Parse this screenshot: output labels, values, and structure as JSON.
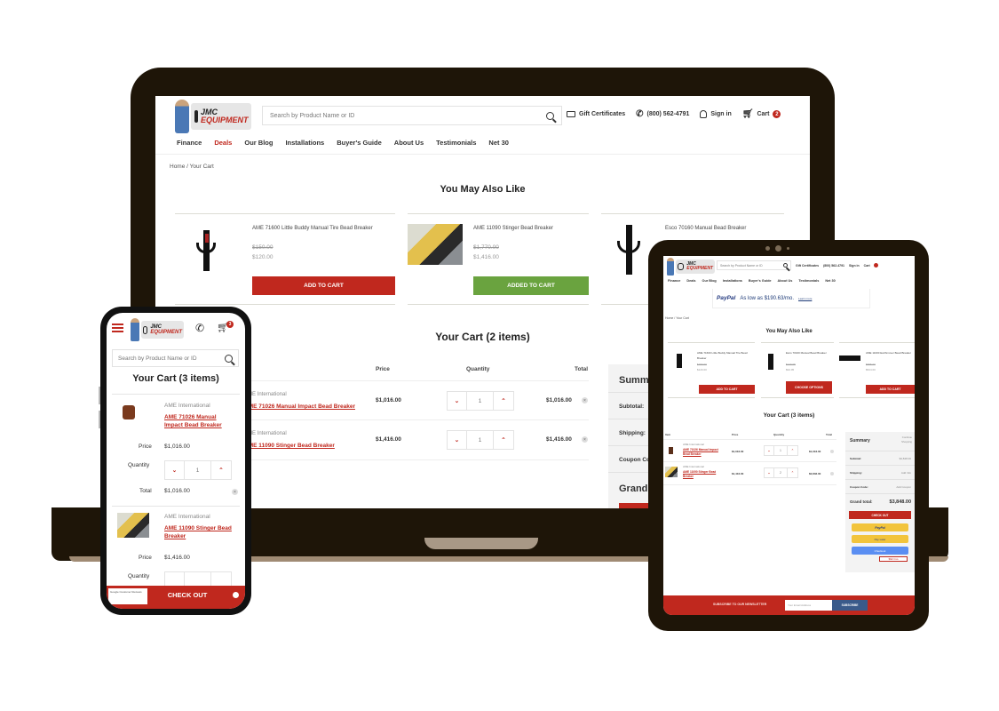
{
  "site": {
    "logo_text_top": "JMC",
    "logo_text_bottom": "EQUIPMENT",
    "search_placeholder": "Search by Product Name or ID",
    "gift_certificates": "Gift Certificates",
    "phone": "(800) 562-4791",
    "sign_in": "Sign in",
    "cart_label": "Cart",
    "cart_count": "2",
    "nav": [
      "Finance",
      "Deals",
      "Our Blog",
      "Installations",
      "Buyer's Guide",
      "About Us",
      "Testimonials",
      "Net 30"
    ],
    "breadcrumb": "Home / Your Cart",
    "accent_color": "#c0281e",
    "success_color": "#6aa33f"
  },
  "laptop": {
    "recommend_title": "You May Also Like",
    "recommendations": [
      {
        "name": "AME 71600 Little Buddy Manual Tire Bead Breaker",
        "old_price": "$150.00",
        "price": "$120.00",
        "button": "ADD TO CART",
        "state": "default"
      },
      {
        "name": "AME 11090 Stinger Bead Breaker",
        "old_price": "$1,770.00",
        "price": "$1,416.00",
        "button": "ADDED TO CART",
        "state": "added"
      },
      {
        "name": "Esco 70160 Manual Bead Breaker",
        "old_price": "",
        "price": "",
        "button": "",
        "state": "default"
      }
    ],
    "cart_title": "Your Cart (2 items)",
    "columns": {
      "price": "Price",
      "quantity": "Quantity",
      "total": "Total"
    },
    "items": [
      {
        "brand": "AME International",
        "name": "AME 71026 Manual Impact Bead Breaker",
        "price": "$1,016.00",
        "qty": "1",
        "total": "$1,016.00"
      },
      {
        "brand": "AME International",
        "name": "AME 11090 Stinger Bead Breaker",
        "price": "$1,416.00",
        "qty": "1",
        "total": "$1,416.00"
      }
    ],
    "summary": {
      "title": "Summary",
      "subtotal": "Subtotal:",
      "shipping": "Shipping:",
      "coupon": "Coupon Code:",
      "grand_total": "Grand total:"
    }
  },
  "tablet": {
    "paypal_brand": "PayPal",
    "paypal_offer": "As low as $190.63/mo.",
    "paypal_learn": "Learn more",
    "recommend_title": "You May Also Like",
    "recommendations": [
      {
        "name": "AME 71600 Little Buddy Manual Tire Bead Breaker",
        "old_price": "$150.00",
        "price": "$120.00",
        "button": "ADD TO CART"
      },
      {
        "name": "Esco 70160 Manual Bead Breaker",
        "old_price": "$129.95",
        "price": "$94.95",
        "button": "CHOOSE OPTIONS"
      },
      {
        "name": "AME 11000 Earthmover Bead Breaker",
        "old_price": "$655.00",
        "price": "$524.00",
        "button": "ADD TO CART"
      }
    ],
    "cart_title": "Your Cart (3 items)",
    "columns": {
      "item": "Item",
      "price": "Price",
      "quantity": "Quantity",
      "total": "Total"
    },
    "items": [
      {
        "brand": "AME International",
        "name": "AME 71026 Manual Impact Bead Breaker",
        "price": "$1,016.00",
        "qty": "1",
        "total": "$1,016.00"
      },
      {
        "brand": "AME International",
        "name": "AME 11090 Stinger Bead Breaker",
        "price": "$1,416.00",
        "qty": "2",
        "total": "$2,832.00"
      }
    ],
    "summary": {
      "title": "Summary",
      "continue": "Continue Shopping",
      "subtotal_label": "Subtotal:",
      "subtotal": "$3,848.00",
      "shipping_label": "Shipping:",
      "shipping": "Add Info",
      "coupon_label": "Coupon Code:",
      "coupon": "Add Coupon",
      "grand_label": "Grand total:",
      "grand": "$3,848.00",
      "checkout": "CHECK OUT",
      "paypal": "PayPal",
      "paylater": "Pay Later",
      "checkout_alt": "Checkout",
      "financing": "$92 /mo"
    },
    "newsletter": {
      "label": "SUBSCRIBE TO OUR NEWSLETTER",
      "placeholder": "Your Email Address",
      "button": "SUBSCRIBE"
    }
  },
  "phone": {
    "cart_count": "3",
    "search_placeholder": "Search by Product Name or ID",
    "cart_title": "Your Cart (3 items)",
    "labels": {
      "price": "Price",
      "quantity": "Quantity",
      "total": "Total"
    },
    "items": [
      {
        "brand": "AME International",
        "name": "AME 71026 Manual Impact Bead Breaker",
        "price": "$1,016.00",
        "qty": "1",
        "total": "$1,016.00"
      },
      {
        "brand": "AME International",
        "name": "AME 11090 Stinger Bead Breaker",
        "price": "$1,416.00",
        "qty": "",
        "total": ""
      }
    ],
    "checkout": "CHECK OUT",
    "reviews_badge": "Google Customer Reviews"
  }
}
